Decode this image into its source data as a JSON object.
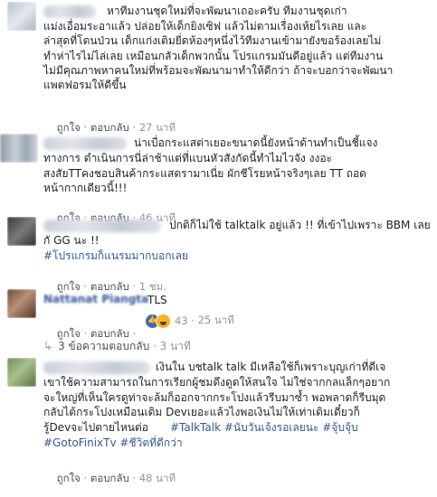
{
  "comments": [
    {
      "lines": [
        "หาทีมงานชุดใหม่ที่จะพัฒนาเถอะครับ ทีมงานชุดเก่า",
        "แม่งเอื่อมระอาแล้ว ปล่อยให้เด็กยิงเซิฟ แล้วไม่ตามเรื่องเห้ยไรเลย และ",
        "ล่าสุดที่โดนป่วน เด็กแก่งเติมยี่ดห้องๆหนึ่งไว้ทีมงานเข้ามายังขอร้องเลยไม่",
        "ทำห่าไรไม่ไล่เลย เหมือนกลัวเด็กพวกนั้น โปรแกรมมันดีอยู่แล้ว แต่ทีมงาน",
        "ไม่มีคุณภาพหาคนใหม่ที่พร้อมจะพัฒนามาทำให้ดีกว่า ถ้าจะบอกว่าจะพัฒนา",
        "แพตฟอรมให้ดีขึ้น"
      ],
      "like_label": "ถูกใจ",
      "reply_label": "ตอบกลับ",
      "time": "27 นาที"
    },
    {
      "lines": [
        "น่าเบื่อกระแสต่าเยอะขนาดนี้ยังหน้าด้านทำเป็นชี้แจง",
        "ทางการ ดำเนินการนี่ล่าช้าแต่ที่แบนหัวสังกัดนี้ทำไมไวจัง งงอะ",
        "สงสัยTTคงชอบสินค้ากระแสดรามาเนี่ย ผักชีโรยหน้าจริงๆเลย TT ถอด",
        "หน้ากากเดียวนี้!!!"
      ],
      "like_label": "ถูกใจ",
      "reply_label": "ตอบกลับ",
      "time": "46 นาที"
    },
    {
      "lines": [
        "ปกติก็ไม่ใช้ talktalk อยู่แล้ว !! ที่เข้าไปเพราะ BBM เลย",
        "กั GG นะ !!"
      ],
      "hashtag": "#โปรแกรมก็แนรมมากบอกเลย",
      "like_label": "ถูกใจ",
      "reply_label": "ตอบกลับ",
      "time": "1 ชม."
    },
    {
      "name": "Nattanat Piangta",
      "lines": [
        "TLS"
      ],
      "like_label": "ถูกใจ",
      "reply_label": "ตอบกลับ",
      "reaction_count": "43",
      "time": "25 นาที",
      "replies_label": "3 ข้อความตอบกลับ",
      "replies_time": "3 นาที"
    },
    {
      "lines": [
        "เงินใน บชtalk talk มีเหลือใช้ก็เพราะบุญเก่าที่ดีเจ",
        "เขาใช้ความสามารถในการเรียกผู้ชมดึงดูดให้สนใจ ไม่ใช่จากกลแล็กๆอยาก",
        "จะใหญ่ที่เห็นใครดูท่าจะล้มก็ออกจากกระโปงแล้วรีบมาซ้ำ พอพลาดก็รีบมุด",
        "กลับไต้กระโปงเหมือนเดิม Devเยอะแล้วไงพอเงินไม่ให้เท่าเดิมเดี๋ยวก็",
        "รู้Devจะไปตายไหนต่อ"
      ],
      "hashtags_1": "#TalkTalk #นับวันเจ้งรอเลยนะ #จุ้บจุ้บ",
      "hashtags_2": "#GotoFinixTv #ชีวิตที่ดีกว่า",
      "like_label": "ถูกใจ",
      "reply_label": "ตอบกลับ",
      "time": "48 นาที"
    }
  ]
}
